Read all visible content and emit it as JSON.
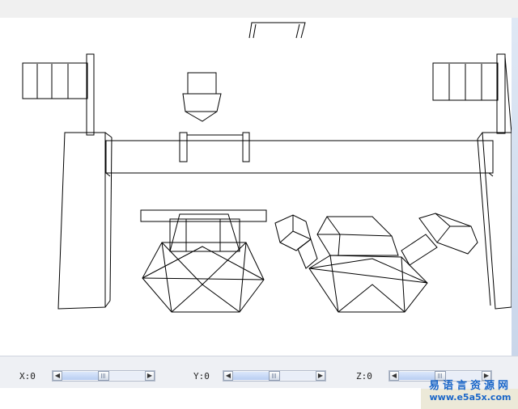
{
  "axes": [
    {
      "label": "X:0",
      "value": 0.5
    },
    {
      "label": "Y:0",
      "value": 0.5
    },
    {
      "label": "Z:0",
      "value": 0.5
    }
  ],
  "scroll_icons": {
    "left": "arrow-left-icon",
    "right": "arrow-right-icon"
  },
  "watermark": {
    "chinese": "易语言资源网",
    "url": "www.e5a5x.com"
  },
  "colors": {
    "watermark": "#1a66c8",
    "line": "#000000"
  }
}
